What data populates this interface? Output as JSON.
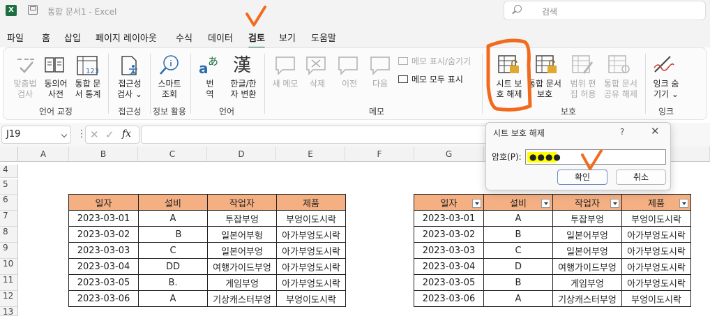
{
  "titlebar": {
    "app_icon": "X",
    "title": "통합 문서1  -  Excel",
    "search_placeholder": "검색"
  },
  "menu": [
    "파일",
    "홈",
    "삽입",
    "페이지 레이아웃",
    "수식",
    "데이터",
    "검토",
    "보기",
    "도움말"
  ],
  "ribbon": {
    "spell": "맞춤법\n검사",
    "thesaurus": "동의어\n사전",
    "stats": "통합 문\n서 통계",
    "g1": "언어 교정",
    "access": "접근성\n검사 ⌄",
    "g2": "접근성",
    "smart": "스마트\n조회",
    "g3": "정보 활용",
    "translate": "번\n역",
    "hanja": "한글/한\n자 변환",
    "g4": "언어",
    "newmemo": "새 메모",
    "del": "삭제",
    "prev": "이전",
    "next": "다음",
    "showhide": "메모 표시/숨기기",
    "showall": "메모 모두 표시",
    "g5": "메모",
    "unprotect_sheet": "시트 보\n호 해제",
    "protect_book": "통합 문서\n보호",
    "allow_range": "범위 편\n집 허용",
    "unshare": "통합 문서\n공유 해제",
    "g6": "보호",
    "hide_ink": "잉크 숨\n기기 ⌄",
    "g7": "잉크"
  },
  "formula": {
    "namebox": "J19",
    "fx": "fx"
  },
  "columns": [
    "A",
    "B",
    "C",
    "D",
    "E",
    "F",
    "G"
  ],
  "rows": [
    "4",
    "5",
    "6",
    "7",
    "8",
    "9",
    "10",
    "11",
    "12",
    "13"
  ],
  "table1": {
    "headers": [
      "일자",
      "설비",
      "작업자",
      "제품"
    ],
    "rows": [
      [
        "2023-03-01",
        "A",
        "투잡부엉",
        "부엉이도시락"
      ],
      [
        "2023-03-02",
        "B",
        "일본어부헝",
        "아가부엉도시락"
      ],
      [
        "2023-03-03",
        "C",
        "일본어부엉",
        "아가부엉도시락"
      ],
      [
        "2023-03-04",
        "DD",
        "여행가이드부엉",
        "아가부엉도시락"
      ],
      [
        "2023-03-05",
        "B.",
        "게임부엉",
        "아가부엉도시락"
      ],
      [
        "2023-03-06",
        "A",
        "기상캐스터부엉",
        "부엉이도시락"
      ]
    ]
  },
  "table2": {
    "headers": [
      "일자",
      "설비",
      "작업자",
      "제품"
    ],
    "rows": [
      [
        "2023-03-01",
        "A",
        "투잡부엉",
        "부엉이도시락"
      ],
      [
        "2023-03-02",
        "B",
        "일본어부엉",
        "아가부엉도시락"
      ],
      [
        "2023-03-03",
        "C",
        "일본어부엉",
        "아가부엉도시락"
      ],
      [
        "2023-03-04",
        "D",
        "여행가이드부엉",
        "아가부엉도시락"
      ],
      [
        "2023-03-05",
        "B",
        "게임부엉",
        "아가부엉도시락"
      ],
      [
        "2023-03-06",
        "A",
        "기상캐스터부엉",
        "부엉이도시락"
      ]
    ]
  },
  "dialog": {
    "title": "시트 보호 해제",
    "help": "?",
    "close": "✕",
    "label": "암호(P):",
    "password": "●●●●",
    "ok": "확인",
    "cancel": "취소"
  },
  "colors": {
    "header_fill": "#f4b083",
    "accent_green": "#217346",
    "annotation": "#f26b1d"
  }
}
